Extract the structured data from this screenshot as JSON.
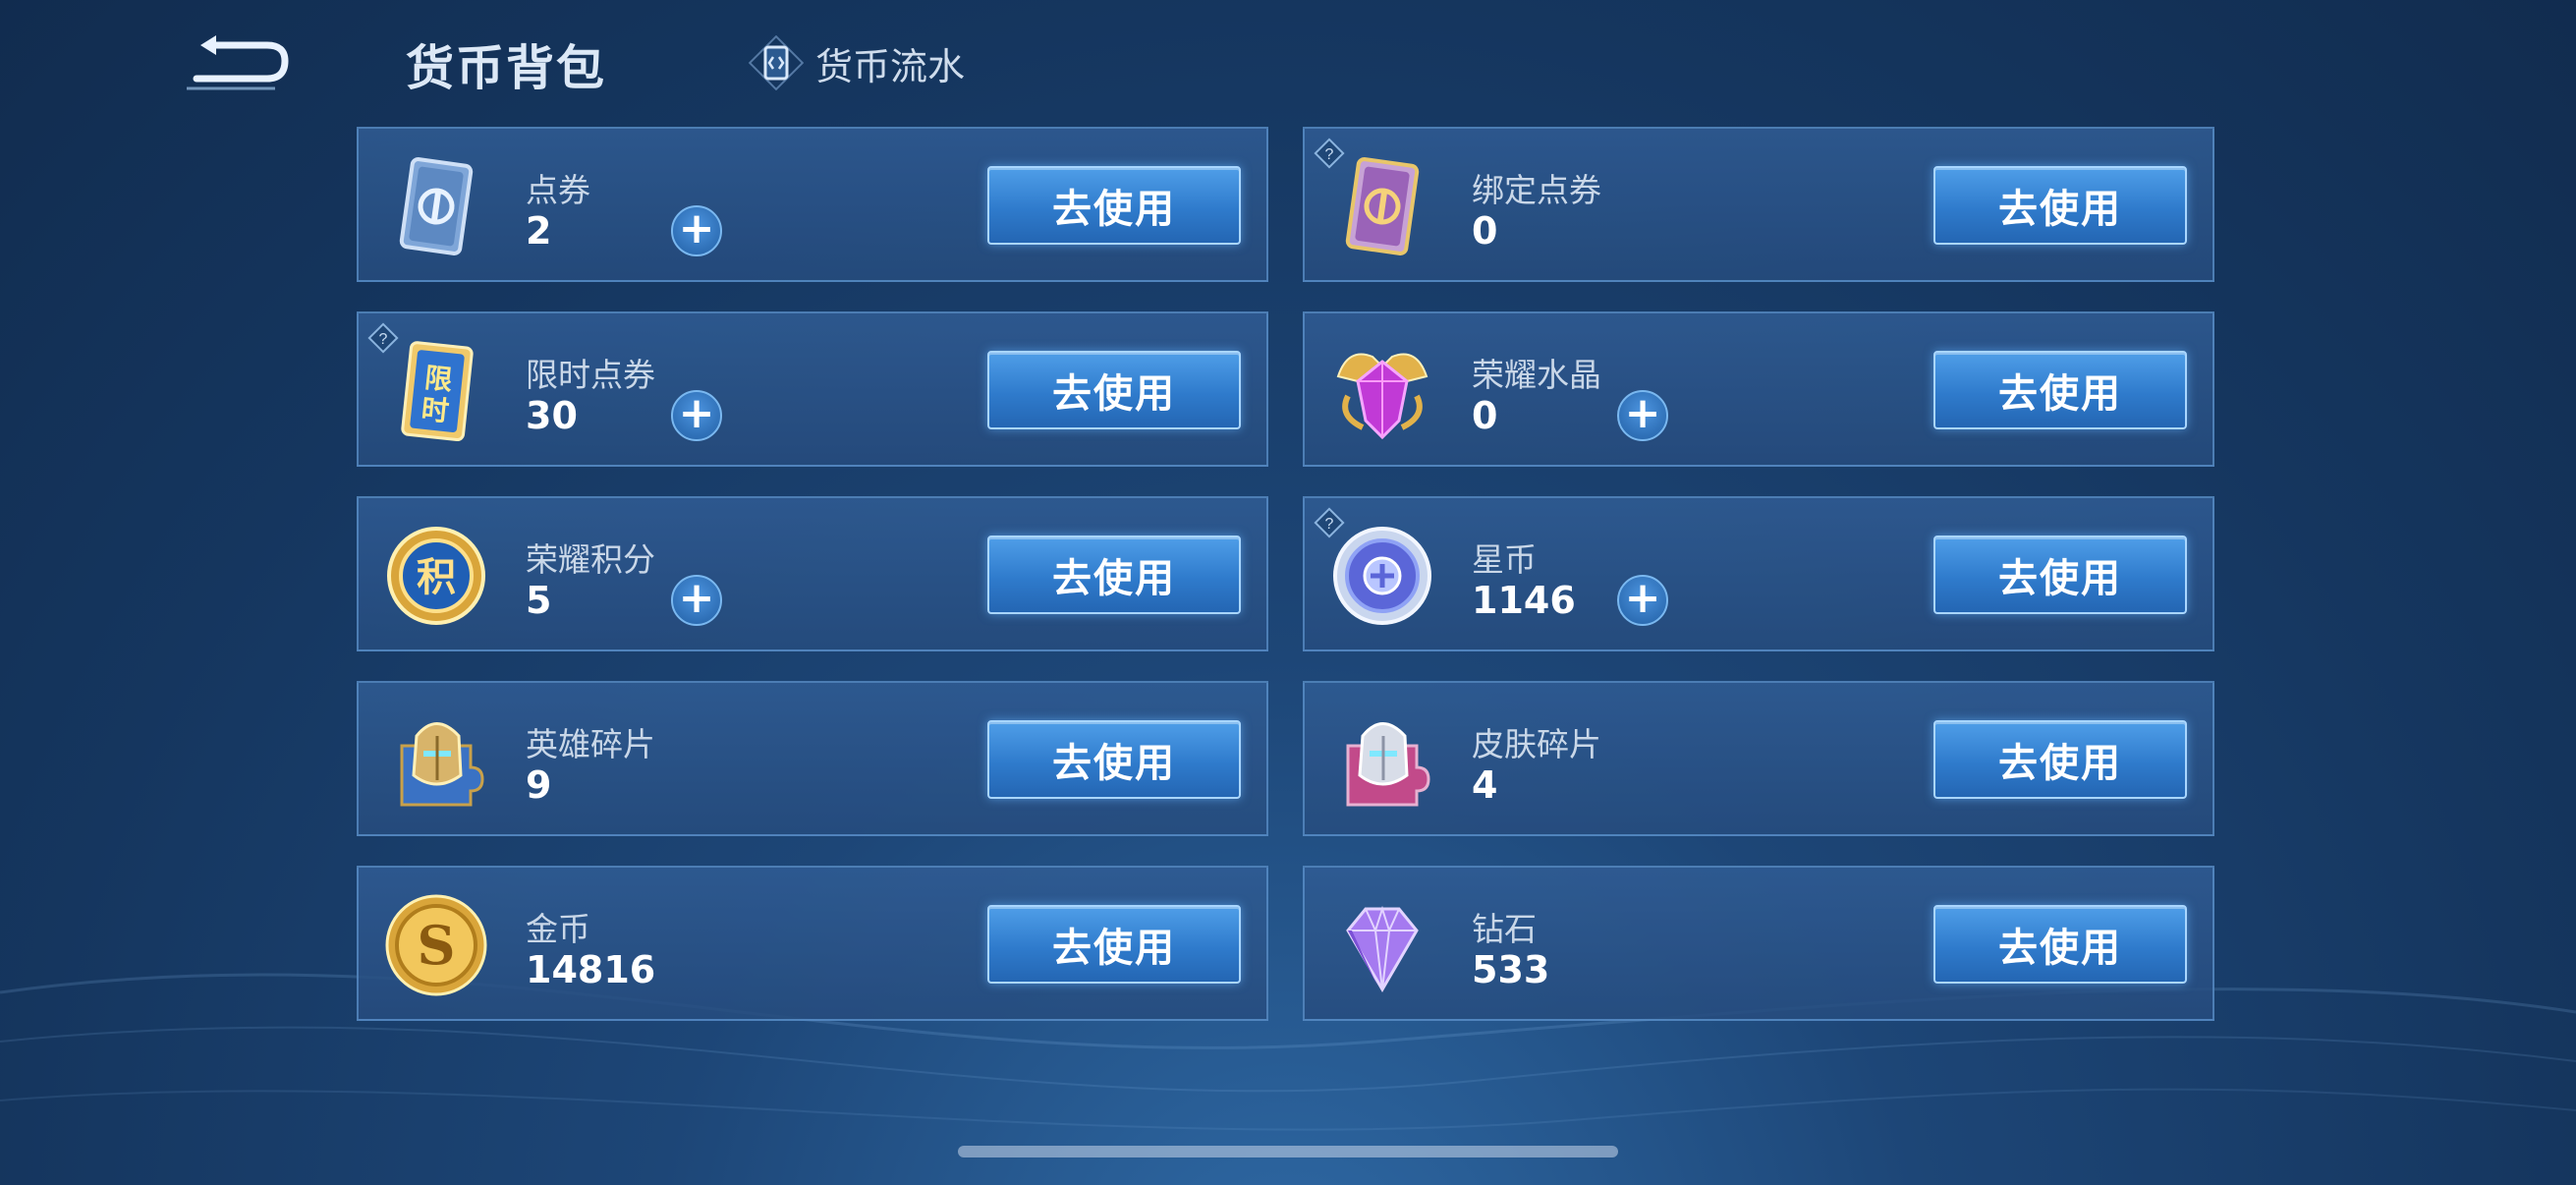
{
  "header": {
    "title": "货币背包",
    "flow_label": "货币流水"
  },
  "currencies": [
    {
      "name": "点券",
      "amount": "2",
      "button": "去使用",
      "icon": "coupon-card-icon",
      "has_plus": true,
      "has_help": false
    },
    {
      "name": "绑定点券",
      "amount": "0",
      "button": "去使用",
      "icon": "bound-coupon-card-icon",
      "has_plus": false,
      "has_help": true
    },
    {
      "name": "限时点券",
      "amount": "30",
      "button": "去使用",
      "icon": "limited-coupon-icon",
      "icon_text": "限时",
      "has_plus": true,
      "has_help": true
    },
    {
      "name": "荣耀水晶",
      "amount": "0",
      "button": "去使用",
      "icon": "glory-crystal-icon",
      "has_plus": true,
      "has_help": false
    },
    {
      "name": "荣耀积分",
      "amount": "5",
      "button": "去使用",
      "icon": "glory-points-icon",
      "icon_text": "积",
      "has_plus": true,
      "has_help": false
    },
    {
      "name": "星币",
      "amount": "1146",
      "button": "去使用",
      "icon": "star-coin-icon",
      "has_plus": true,
      "has_help": true
    },
    {
      "name": "英雄碎片",
      "amount": "9",
      "button": "去使用",
      "icon": "hero-fragment-icon",
      "has_plus": false,
      "has_help": false
    },
    {
      "name": "皮肤碎片",
      "amount": "4",
      "button": "去使用",
      "icon": "skin-fragment-icon",
      "has_plus": false,
      "has_help": false
    },
    {
      "name": "金币",
      "amount": "14816",
      "button": "去使用",
      "icon": "gold-coin-icon",
      "icon_text": "S",
      "has_plus": false,
      "has_help": false
    },
    {
      "name": "钻石",
      "amount": "533",
      "button": "去使用",
      "icon": "diamond-icon",
      "has_plus": false,
      "has_help": false
    }
  ],
  "colors": {
    "background": "#15365f",
    "card_border": "#6ea8e2",
    "button": "#2f7bcc",
    "text_label": "#c9d7e8"
  }
}
